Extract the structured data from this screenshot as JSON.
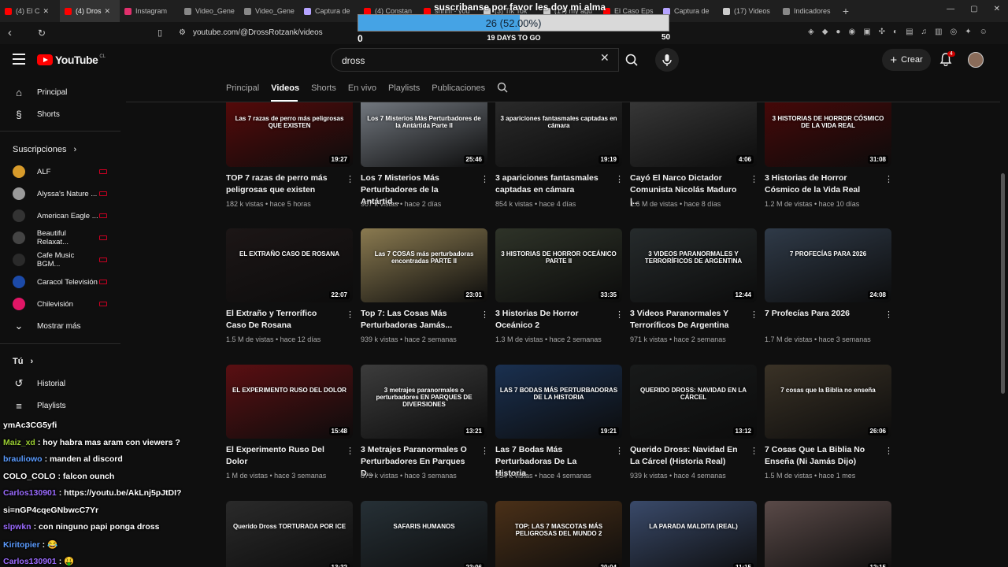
{
  "browser": {
    "tabs": [
      {
        "label": "(4) El C",
        "color": "#ff0000",
        "active": false
      },
      {
        "label": "(4) Dros",
        "color": "#ff0000",
        "active": true
      },
      {
        "label": "Instagram",
        "color": "#e1306c",
        "active": false
      },
      {
        "label": "Video_Gene",
        "color": "#888888",
        "active": false
      },
      {
        "label": "Video_Gene",
        "color": "#888888",
        "active": false
      },
      {
        "label": "Captura de",
        "color": "#b5a3ff",
        "active": false
      },
      {
        "label": "(4) Constan",
        "color": "#ff0000",
        "active": false
      },
      {
        "label": "shrim - you",
        "color": "#ff0000",
        "active": false
      },
      {
        "label": "(3) Tik Tok",
        "color": "#cccccc",
        "active": false
      },
      {
        "label": "(17) my agu",
        "color": "#cccccc",
        "active": false
      },
      {
        "label": "El Caso Eps",
        "color": "#ff0000",
        "active": false
      },
      {
        "label": "Captura de",
        "color": "#b5a3ff",
        "active": false
      },
      {
        "label": "(17) Videos",
        "color": "#cccccc",
        "active": false
      },
      {
        "label": "Indicadores",
        "color": "#888888",
        "active": false
      }
    ],
    "new_tab": "+",
    "url": "youtube.com/@DrossRotzank/videos"
  },
  "overlay": {
    "banner": "suscribanse por favor les doy mi alma",
    "goal_text": "26 (52.00%)",
    "goal_fraction": 0.52,
    "goal_min": "0",
    "goal_max": "50",
    "goal_days": "19 DAYS TO GO"
  },
  "header": {
    "logo": "YouTube",
    "country": "CL",
    "search_value": "dross",
    "create_label": "Crear",
    "notif_count": "4"
  },
  "sidebar": {
    "home": "Principal",
    "shorts": "Shorts",
    "subs_heading": "Suscripciones",
    "channels": [
      {
        "name": "ALF",
        "color": "#d79b2b"
      },
      {
        "name": "Alyssa's Nature ...",
        "color": "#9a9a9a"
      },
      {
        "name": "American Eagle ...",
        "color": "#333333"
      },
      {
        "name": "Beautiful Relaxat...",
        "color": "#444444"
      },
      {
        "name": "Cafe Music BGM...",
        "color": "#2a2a2a"
      },
      {
        "name": "Caracol Televisión",
        "color": "#1c4aa8"
      },
      {
        "name": "Chilevisión",
        "color": "#e01666"
      }
    ],
    "show_more": "Mostrar más",
    "you_heading": "Tú",
    "history": "Historial",
    "playlists": "Playlists"
  },
  "channel_tabs": [
    "Principal",
    "Videos",
    "Shorts",
    "En vivo",
    "Playlists",
    "Publicaciones"
  ],
  "videos": [
    {
      "title": "TOP 7 razas de perro más peligrosas que existen",
      "meta": "182 k vistas • hace 5 horas",
      "duration": "19:27",
      "thumb_text": "Las 7 razas de perro más peligrosas QUE EXISTEN",
      "bg": "#5a0a0a"
    },
    {
      "title": "Los 7 Misterios Más Perturbadores de la Antártid...",
      "meta": "907 k vistas • hace 2 días",
      "duration": "25:46",
      "thumb_text": "Los 7 Misterios Más Perturbadores de la Antártida Parte II",
      "bg": "#7a8088"
    },
    {
      "title": "3 apariciones fantasmales captadas en cámara",
      "meta": "854 k vistas • hace 4 días",
      "duration": "19:19",
      "thumb_text": "3 apariciones fantasmales captadas en cámara",
      "bg": "#2c2c2c"
    },
    {
      "title": "Cayó El Narco Dictador Comunista Nicolás Maduro |...",
      "meta": "1.6 M de vistas • hace 8 días",
      "duration": "4:06",
      "thumb_text": "",
      "bg": "#3a3a3a"
    },
    {
      "title": "3 Historias de Horror Cósmico de la Vida Real",
      "meta": "1.2 M de vistas • hace 10 días",
      "duration": "31:08",
      "thumb_text": "3 HISTORIAS DE HORROR CÓSMICO DE LA VIDA REAL",
      "bg": "#4a0808"
    },
    {
      "title": "El Extraño y Terrorífico Caso De Rosana",
      "meta": "1.5 M de vistas • hace 12 días",
      "duration": "22:07",
      "thumb_text": "EL EXTRAÑO CASO DE ROSANA",
      "bg": "#1c1616"
    },
    {
      "title": "Top 7: Las Cosas Más Perturbadoras Jamás...",
      "meta": "939 k vistas • hace 2 semanas",
      "duration": "23:01",
      "thumb_text": "Las 7 COSAS más perturbadoras encontradas PARTE II",
      "bg": "#8a7a50"
    },
    {
      "title": "3 Historias De Horror Oceánico 2",
      "meta": "1.3 M de vistas • hace 2 semanas",
      "duration": "33:35",
      "thumb_text": "3 HISTORIAS DE HORROR OCEÁNICO PARTE II",
      "bg": "#2e3328"
    },
    {
      "title": "3 Videos Paranormales Y Terroríficos De Argentina",
      "meta": "971 k vistas • hace 2 semanas",
      "duration": "12:44",
      "thumb_text": "3 VIDEOS PARANORMALES Y TERRORÍFICOS DE ARGENTINA",
      "bg": "#262b2c"
    },
    {
      "title": "7 Profecías Para 2026",
      "meta": "1.7 M de vistas • hace 3 semanas",
      "duration": "24:08",
      "thumb_text": "7 PROFECÍAS PARA 2026",
      "bg": "#2f3a48"
    },
    {
      "title": "El Experimento Ruso Del Dolor",
      "meta": "1 M de vistas • hace 3 semanas",
      "duration": "15:48",
      "thumb_text": "EL EXPERIMENTO RUSO DEL DOLOR",
      "bg": "#5a0f12"
    },
    {
      "title": "3 Metrajes Paranormales O Perturbadores En Parques D...",
      "meta": "873 k vistas • hace 3 semanas",
      "duration": "13:21",
      "thumb_text": "3 metrajes paranormales o perturbadores EN PARQUES DE DIVERSIONES",
      "bg": "#3c3c3c"
    },
    {
      "title": "Las 7 Bodas Más Perturbadoras De La Historia",
      "meta": "934 k vistas • hace 4 semanas",
      "duration": "19:21",
      "thumb_text": "LAS 7 BODAS MÁS PERTURBADORAS DE LA HISTORIA",
      "bg": "#1a3050"
    },
    {
      "title": "Querido Dross: Navidad En La Cárcel (Historia Real)",
      "meta": "939 k vistas • hace 4 semanas",
      "duration": "13:12",
      "thumb_text": "QUERIDO DROSS: NAVIDAD EN LA CÁRCEL",
      "bg": "#181a1a"
    },
    {
      "title": "7 Cosas Que La Biblia No Enseña (Ni Jamás Dijo)",
      "meta": "1.5 M de vistas • hace 1 mes",
      "duration": "26:06",
      "thumb_text": "7 cosas que la Biblia no enseña",
      "bg": "#3a3226"
    },
    {
      "title": "",
      "meta": "",
      "duration": "13:32",
      "thumb_text": "Querido Dross TORTURADA POR ICE",
      "bg": "#2a2a2a"
    },
    {
      "title": "",
      "meta": "",
      "duration": "23:06",
      "thumb_text": "SAFARIS HUMANOS",
      "bg": "#263036"
    },
    {
      "title": "",
      "meta": "",
      "duration": "20:04",
      "thumb_text": "TOP: LAS 7 MASCOTAS MÁS PELIGROSAS DEL MUNDO 2",
      "bg": "#4a3018"
    },
    {
      "title": "",
      "meta": "",
      "duration": "11:15",
      "thumb_text": "LA PARADA MALDITA (REAL)",
      "bg": "#3a4a6a"
    },
    {
      "title": "",
      "meta": "",
      "duration": "12:15",
      "thumb_text": "",
      "bg": "#5a4a48"
    }
  ],
  "chat": [
    {
      "user": "",
      "text": "ymAc3CG5yfi",
      "user_color": "#ffffff"
    },
    {
      "user": "Maiz_xd",
      "text": ": hoy habra mas aram con viewers ?",
      "user_color": "#9acd32"
    },
    {
      "user": "brauliowo",
      "text": ": manden al discord",
      "user_color": "#5b9cff"
    },
    {
      "user": "COLO_COLO",
      "text": ": falcon ounch",
      "user_color": "#ffffff"
    },
    {
      "user": "Carlos130901",
      "text": ": https://youtu.be/AkLnj5pJtDI?",
      "user_color": "#9b6bff"
    },
    {
      "user": "",
      "text": "si=nGP4cqeGNbwcC7Yr",
      "user_color": "#ffffff"
    },
    {
      "user": "slpwkn",
      "text": ": con ninguno papi ponga dross",
      "user_color": "#9b6bff"
    },
    {
      "user": "Kiritopier",
      "text": ": 😂",
      "user_color": "#5b9cff"
    },
    {
      "user": "Carlos130901",
      "text": ": 🤑",
      "user_color": "#9b6bff"
    }
  ]
}
